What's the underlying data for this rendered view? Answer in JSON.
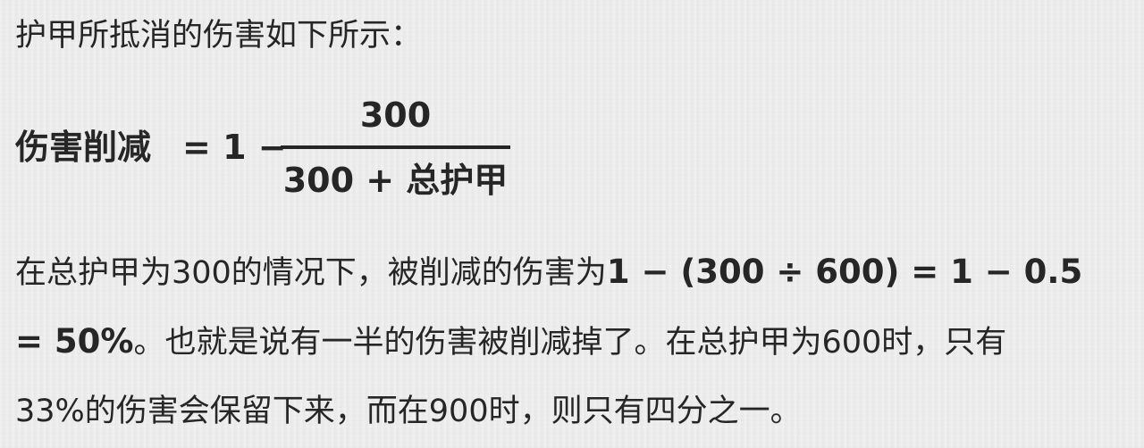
{
  "intro": "护甲所抵消的伤害如下所示：",
  "formula": {
    "lhs": "伤害削减",
    "eq": "= 1 −",
    "numerator": "300",
    "denominator": "300 + 总护甲"
  },
  "paragraph": {
    "line1_text": "在总护甲为300的情况下，被削减的伤害为",
    "line1_bold": "1 − (300 ÷ 600) = 1 − 0.5",
    "line2_bold": "= 50%",
    "line2_text": "。也就是说有一半的伤害被削减掉了。在总护甲为600时，只有",
    "line3_text": "33%的伤害会保留下来，而在900时，则只有四分之一。"
  }
}
